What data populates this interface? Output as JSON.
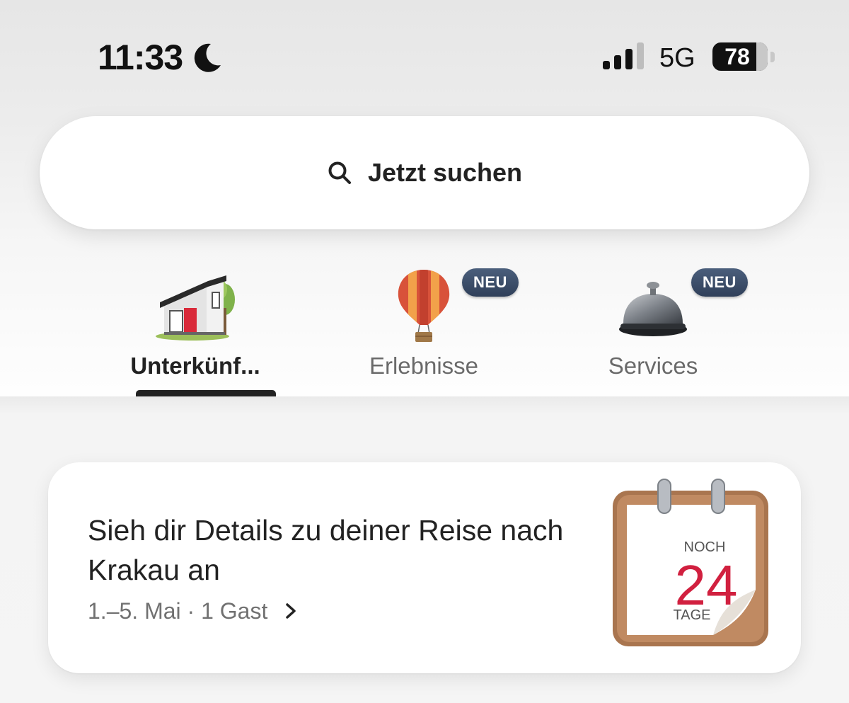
{
  "status_bar": {
    "time": "11:33",
    "network": "5G",
    "battery": "78"
  },
  "search": {
    "label": "Jetzt suchen"
  },
  "tabs": [
    {
      "label": "Unterkünf...",
      "active": true
    },
    {
      "label": "Erlebnisse",
      "badge": "NEU"
    },
    {
      "label": "Services",
      "badge": "NEU"
    }
  ],
  "trip": {
    "title": "Sieh dir Details zu deiner Reise nach Krakau an",
    "meta": "1.–5. Mai · 1 Gast",
    "calendar": {
      "top": "NOCH",
      "days": "24",
      "bottom": "TAGE"
    }
  },
  "colors": {
    "badge": "#3d4e6a",
    "calendar_number": "#d1203f"
  }
}
